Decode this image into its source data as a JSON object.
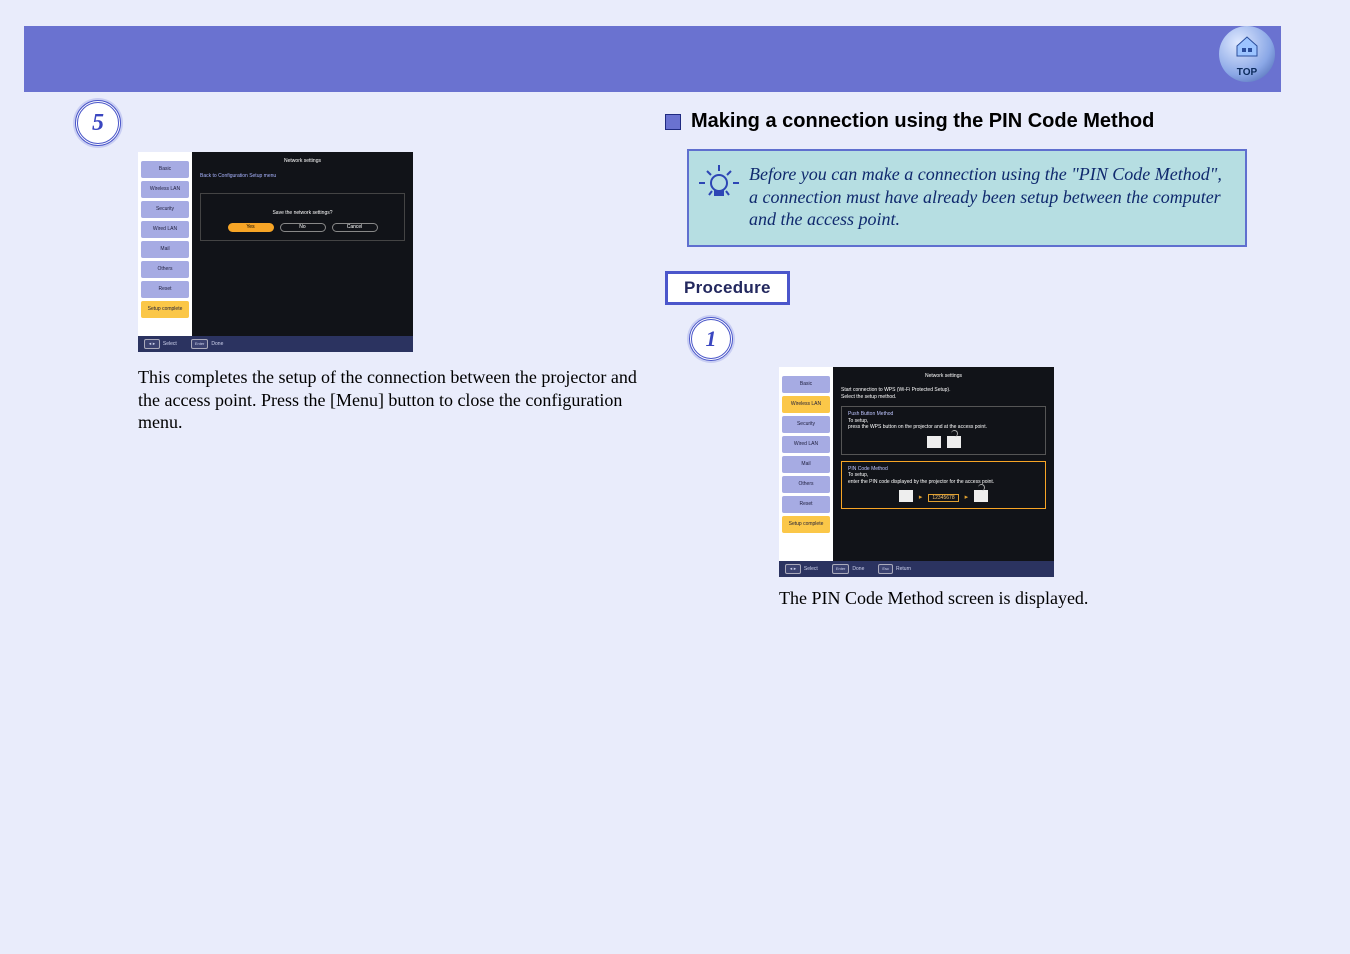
{
  "header": {
    "top_badge_label": "TOP"
  },
  "left": {
    "step_number": "5",
    "shot": {
      "title": "Network settings",
      "back_link": "Back to Configuration Setup menu",
      "question": "Save the network settings?",
      "btn_yes": "Yes",
      "btn_no": "No",
      "btn_cancel": "Cancel",
      "tabs": [
        "Basic",
        "Wireless LAN",
        "Security",
        "Wired LAN",
        "Mail",
        "Others",
        "Reset",
        "Setup complete"
      ],
      "footer_select": "Select",
      "footer_done": "Done"
    },
    "body_text": "This completes the setup of the connection between the projector and the access point. Press the [Menu] button to close the configuration menu."
  },
  "right": {
    "heading": "Making a connection using the PIN Code Method",
    "tip": "Before you can make a connection using the \"PIN Code Method\", a connection must have already been setup between the computer and the access point.",
    "procedure_label": "Procedure",
    "step_number": "1",
    "shot": {
      "title": "Network settings",
      "intro1": "Start connection to WPS (Wi-Fi Protected Setup).",
      "intro2": "Select the setup method.",
      "pb_head": "Push Button Method",
      "pb_sub1": "To setup,",
      "pb_sub2": "press the WPS button on the projector and at the access point.",
      "pin_head": "PIN Code Method",
      "pin_sub1": "To setup,",
      "pin_sub2": "enter the PIN code displayed by the projector for the access point.",
      "pin_value": "12345678",
      "tabs": [
        "Basic",
        "Wireless LAN",
        "Security",
        "Wired LAN",
        "Mail",
        "Others",
        "Reset",
        "Setup complete"
      ],
      "footer_select": "Select",
      "footer_done": "Done",
      "footer_return": "Return"
    },
    "body_text": "The PIN Code Method screen is displayed."
  }
}
